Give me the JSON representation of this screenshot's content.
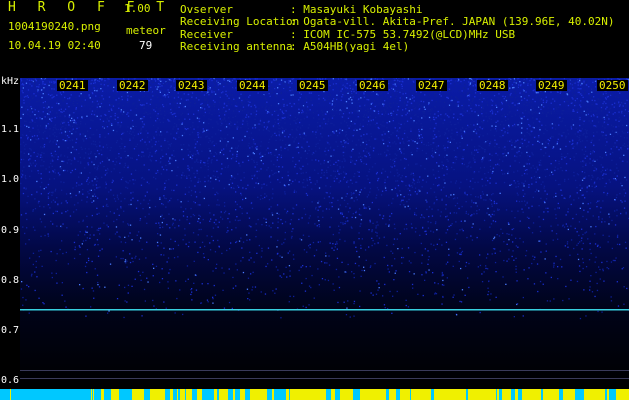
{
  "header": {
    "brand": "H R O F F T",
    "version": "1.00",
    "filename": "1004190240.png",
    "meteor_label": "meteor",
    "datetime": "10.04.19 02:40",
    "meteor_count": "79",
    "info": [
      {
        "label": "Ovserver",
        "value": ": Masayuki Kobayashi"
      },
      {
        "label": "Receiving Location",
        "value": ": Ogata-vill. Akita-Pref. JAPAN (139.96E, 40.02N)"
      },
      {
        "label": "Receiver",
        "value": ": ICOM IC-575 53.7492(@LCD)MHz USB"
      },
      {
        "label": "Receiving antenna",
        "value": ": A504HB(yagi 4el)"
      }
    ]
  },
  "spectrogram": {
    "unit_label": "kHz",
    "time_labels": [
      "0241",
      "0242",
      "0243",
      "0244",
      "0245",
      "0246",
      "0247",
      "0248",
      "0249",
      "0250"
    ],
    "y_ticks": [
      "1.1",
      "1.0",
      "0.9",
      "0.8",
      "0.7",
      "0.6"
    ],
    "colors": {
      "noise_dark": "#000a2a",
      "noise_mid": "#1a2fd0",
      "noise_bright": "#4a7cff",
      "carrier": "#38d0e0",
      "bar_yellow": "#f0f000",
      "bar_cyan": "#00c8ff"
    }
  }
}
